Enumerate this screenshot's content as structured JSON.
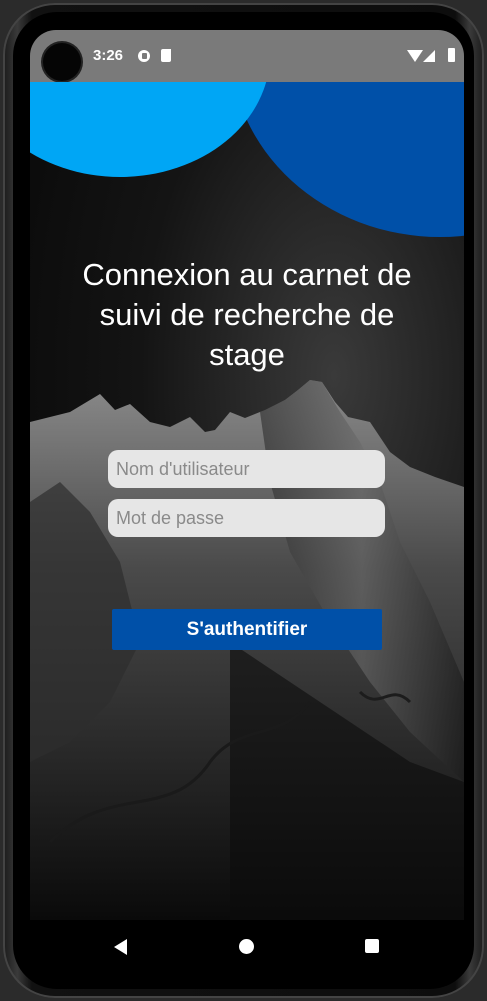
{
  "status_bar": {
    "time": "3:26",
    "icons": [
      "g-notification-icon",
      "sd-card-icon",
      "wifi-icon",
      "signal-icon",
      "battery-icon"
    ]
  },
  "login": {
    "title": "Connexion au carnet de suivi de recherche de stage",
    "username_placeholder": "Nom d'utilisateur",
    "password_placeholder": "Mot de passe",
    "submit_label": "S'authentifier"
  },
  "nav_bar": {
    "icons": [
      "back-icon",
      "home-icon",
      "recent-apps-icon"
    ]
  },
  "colors": {
    "accent_light": "#00a6f5",
    "accent_dark": "#0050a8",
    "field_bg": "#e6e6e6"
  }
}
